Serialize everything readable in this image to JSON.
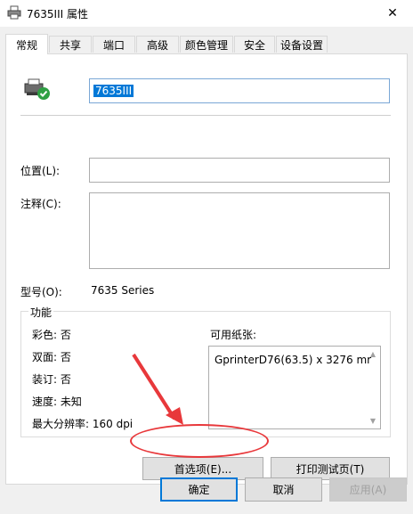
{
  "window": {
    "title": "7635III 属性",
    "close_glyph": "✕"
  },
  "tabs": [
    {
      "label": "常规",
      "active": true
    },
    {
      "label": "共享"
    },
    {
      "label": "端口"
    },
    {
      "label": "高级"
    },
    {
      "label": "颜色管理"
    },
    {
      "label": "安全"
    },
    {
      "label": "设备设置"
    }
  ],
  "general": {
    "printer_name": "7635III",
    "location_label": "位置(L):",
    "location_value": "",
    "comment_label": "注释(C):",
    "comment_value": "",
    "model_label": "型号(O):",
    "model_value": "7635 Series"
  },
  "features": {
    "title": "功能",
    "color": "彩色: 否",
    "duplex": "双面: 否",
    "staple": "装订: 否",
    "speed": "速度: 未知",
    "max_dpi": "最大分辨率: 160 dpi",
    "paper_label": "可用纸张:",
    "paper_items": [
      "GprinterD76(63.5) x 3276 mr"
    ]
  },
  "panel_buttons": {
    "preferences": "首选项(E)...",
    "test_page": "打印测试页(T)"
  },
  "dialog_buttons": {
    "ok": "确定",
    "cancel": "取消",
    "apply": "应用(A)"
  },
  "icons": {
    "title": "printer-icon",
    "printer_status": "printer-ready-icon",
    "close": "close-icon",
    "scroll_up": "scroll-up-icon",
    "scroll_down": "scroll-down-icon"
  },
  "colors": {
    "annotation": "#e8383b",
    "selection": "#0078d7",
    "ready_check": "#2ea043"
  }
}
